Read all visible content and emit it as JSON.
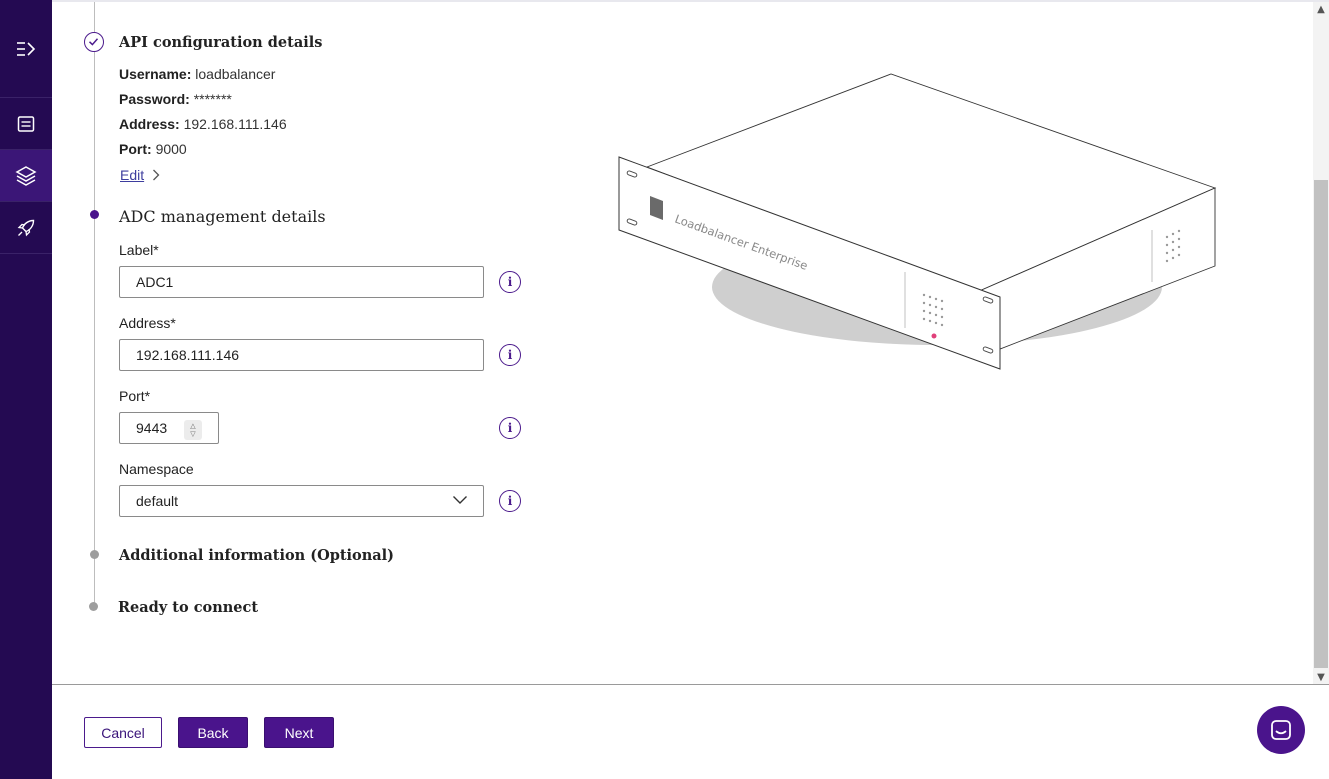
{
  "sidebar": {
    "items": [
      {
        "icon": "expand-menu-icon"
      },
      {
        "icon": "list-icon"
      },
      {
        "icon": "layers-icon",
        "active": true
      },
      {
        "icon": "rocket-icon"
      }
    ]
  },
  "steps": {
    "api_config": {
      "title": "API configuration details",
      "username_label": "Username:",
      "username": "loadbalancer",
      "password_label": "Password:",
      "password": "*******",
      "address_label": "Address:",
      "address": "192.168.111.146",
      "port_label": "Port:",
      "port": "9000",
      "edit_label": "Edit"
    },
    "adc_management": {
      "title": "ADC management details",
      "label_field_label": "Label*",
      "label_value": "ADC1",
      "address_field_label": "Address*",
      "address_value": "192.168.111.146",
      "port_field_label": "Port*",
      "port_value": "9443",
      "namespace_field_label": "Namespace",
      "namespace_value": "default"
    },
    "additional_info": {
      "title": "Additional information (Optional)"
    },
    "ready": {
      "title": "Ready to connect"
    }
  },
  "illustration": {
    "brand_text": "Loadbalancer Enterprise"
  },
  "footer": {
    "cancel_label": "Cancel",
    "back_label": "Back",
    "next_label": "Next"
  },
  "colors": {
    "sidebar_bg": "#240a52",
    "accent": "#4a148c"
  }
}
